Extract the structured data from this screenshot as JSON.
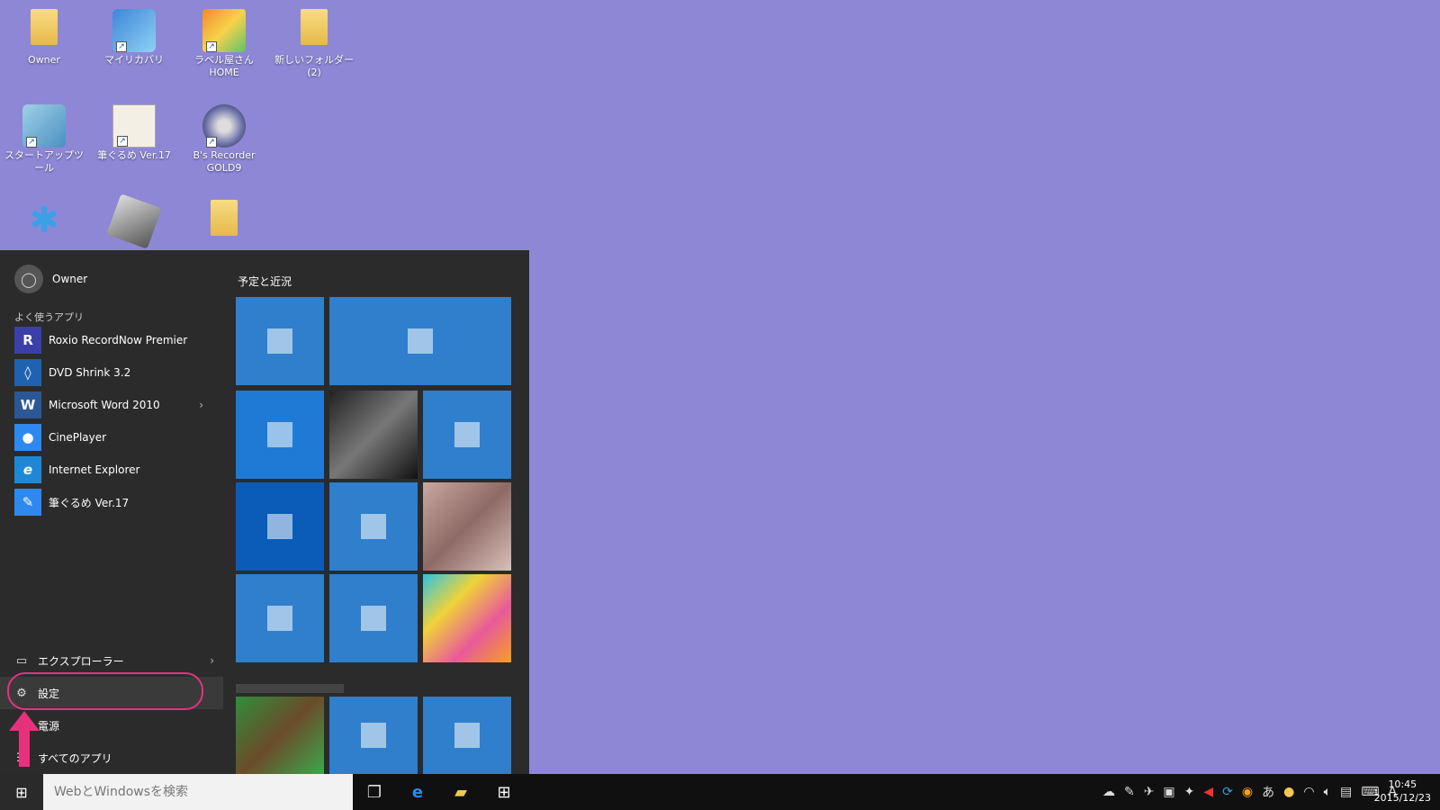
{
  "desktop": {
    "icons": [
      {
        "label": "Owner"
      },
      {
        "label": "マイリカバリ"
      },
      {
        "label": "ラベル屋さんHOME"
      },
      {
        "label": "新しいフォルダー (2)"
      },
      {
        "label": "スタートアップツール"
      },
      {
        "label": "筆ぐるめ Ver.17"
      },
      {
        "label": "B's Recorder GOLD9"
      }
    ]
  },
  "start_menu": {
    "user_name": "Owner",
    "frequent_label": "よく使うアプリ",
    "apps": [
      {
        "label": "Roxio RecordNow Premier",
        "icon": "R"
      },
      {
        "label": "DVD Shrink 3.2",
        "icon": "◊"
      },
      {
        "label": "Microsoft Word 2010",
        "icon": "W"
      },
      {
        "label": "CinePlayer",
        "icon": "●"
      },
      {
        "label": "Internet Explorer",
        "icon": "e"
      },
      {
        "label": "筆ぐるめ Ver.17",
        "icon": "✎"
      }
    ],
    "bottom": {
      "explorer": "エクスプローラー",
      "settings": "設定",
      "power": "電源",
      "all_apps": "すべてのアプリ"
    },
    "tiles_header": "予定と近況"
  },
  "taskbar": {
    "search_placeholder": "WebとWindowsを検索",
    "ime": "A",
    "time": "10:45",
    "date": "2015/12/23"
  },
  "colors": {
    "desktop_bg": "#8e87d6",
    "tile_blue": "#2f7fcc",
    "highlight": "#e8317d"
  }
}
